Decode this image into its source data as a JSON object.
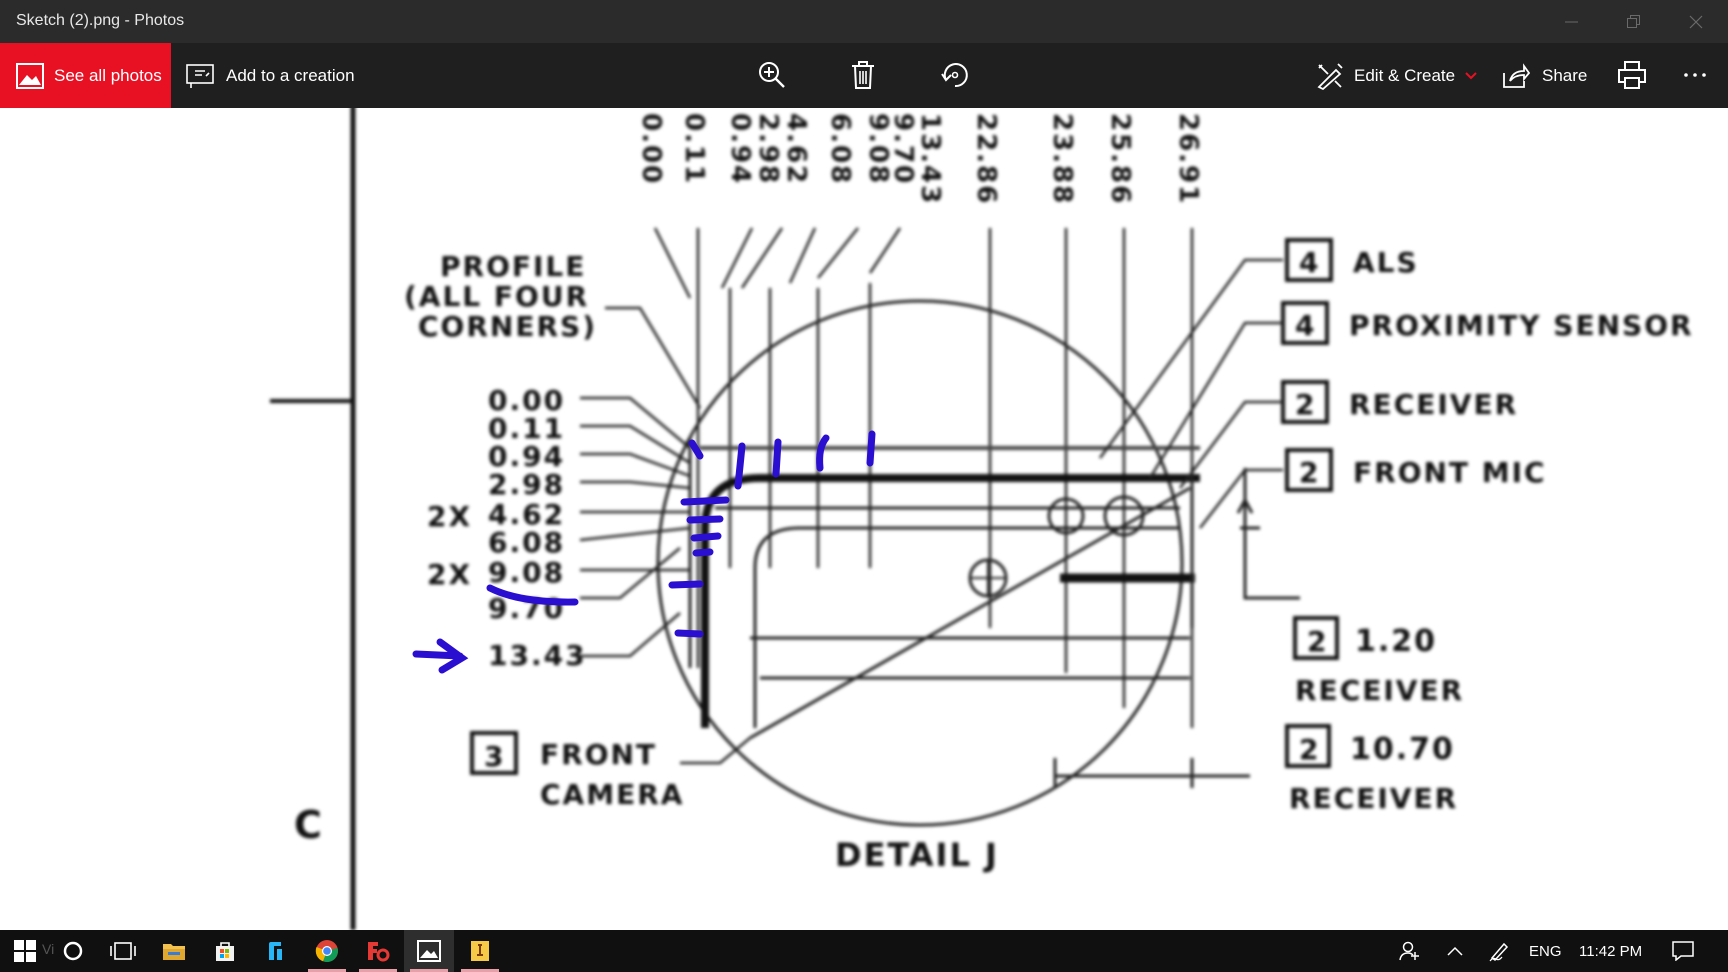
{
  "window": {
    "title": "Sketch (2).png - Photos"
  },
  "toolbar": {
    "see_all_photos": "See all photos",
    "add_to_creation": "Add to a creation",
    "zoom_icon": "zoom-in-icon",
    "delete_icon": "trash-icon",
    "rotate_icon": "rotate-icon",
    "edit_create": "Edit & Create",
    "share": "Share",
    "print_icon": "print-icon",
    "more_icon": "ellipsis-icon"
  },
  "drawing": {
    "top_labels": [
      "0.00",
      "0.11",
      "0.94",
      "2.98",
      "4.62",
      "6.08",
      "9.08",
      "9.70",
      "13.43",
      "22.86",
      "23.88",
      "25.86",
      "26.91"
    ],
    "profile_label_1": "PROFILE",
    "profile_label_2": "(ALL FOUR",
    "profile_label_3": "CORNERS)",
    "left_values": [
      "0.00",
      "0.11",
      "0.94",
      "2.98",
      "4.62",
      "6.08",
      "9.08",
      "9.70",
      "13.43"
    ],
    "twox_a": "2X",
    "twox_b": "2X",
    "callouts": [
      {
        "qty": "4",
        "label": "ALS"
      },
      {
        "qty": "4",
        "label": "PROXIMITY SENSOR"
      },
      {
        "qty": "2",
        "label": "RECEIVER"
      },
      {
        "qty": "2",
        "label": "FRONT MIC"
      }
    ],
    "dim_1": {
      "qty": "2",
      "value": "1.20",
      "label": "RECEIVER"
    },
    "dim_2": {
      "qty": "2",
      "value": "10.70",
      "label": "RECEIVER"
    },
    "front_camera": {
      "qty": "3",
      "line1": "FRONT",
      "line2": "CAMERA"
    },
    "detail_label": "DETAIL J",
    "zone_letter": "C",
    "ink_color": "#2a0fd0"
  },
  "taskbar": {
    "search_ghost": "Vi",
    "language": "ENG",
    "time": "11:42 PM",
    "apps": [
      "windows-start-icon",
      "cortana-icon",
      "task-view-icon",
      "file-explorer-icon",
      "store-icon",
      "app-icon",
      "chrome-icon",
      "foxit-icon",
      "photos-icon",
      "app-yellow-icon"
    ]
  }
}
